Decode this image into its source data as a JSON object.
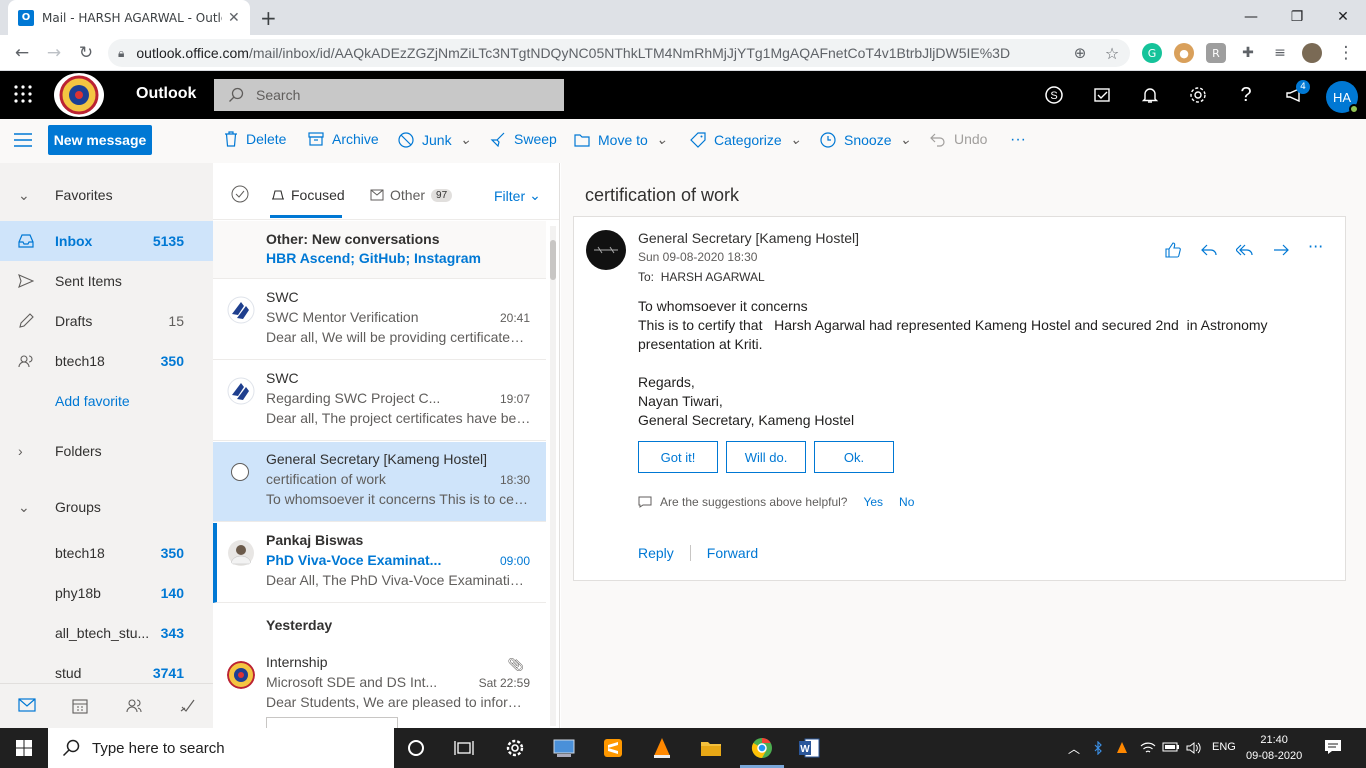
{
  "browser": {
    "tab_title": "Mail - HARSH AGARWAL - Outlo",
    "url_host": "outlook.office.com",
    "url_path": "/mail/inbox/id/AAQkADEzZGZjNmZiLTc3NTgtNDQyNC05NThkLTM4NmRhMjJjYTg1MgAQAFnetCoT4v1BtrbJljDW5IE%3D"
  },
  "header": {
    "app_name": "Outlook",
    "search_placeholder": "Search",
    "notification_count": "4",
    "avatar_initials": "HA"
  },
  "commandbar": {
    "new_message": "New message",
    "delete": "Delete",
    "archive": "Archive",
    "junk": "Junk",
    "sweep": "Sweep",
    "move_to": "Move to",
    "categorize": "Categorize",
    "snooze": "Snooze",
    "undo": "Undo",
    "more": "···"
  },
  "sidebar": {
    "favorites": "Favorites",
    "items": [
      {
        "label": "Inbox",
        "count": "5135"
      },
      {
        "label": "Sent Items",
        "count": ""
      },
      {
        "label": "Drafts",
        "count": "15"
      },
      {
        "label": "btech18",
        "count": "350"
      }
    ],
    "add_favorite": "Add favorite",
    "folders": "Folders",
    "groups": "Groups",
    "group_items": [
      {
        "label": "btech18",
        "count": "350"
      },
      {
        "label": "phy18b",
        "count": "140"
      },
      {
        "label": "all_btech_stu...",
        "count": "343"
      },
      {
        "label": "stud",
        "count": "3741"
      }
    ]
  },
  "list": {
    "focused": "Focused",
    "other": "Other",
    "other_count": "97",
    "filter": "Filter",
    "other_banner_title": "Other: New conversations",
    "other_banner_senders": "HBR Ascend; GitHub; Instagram",
    "messages": [
      {
        "sender": "SWC",
        "subject": "SWC Mentor Verification",
        "time": "20:41",
        "preview": "Dear all, We will be providing certificates to the"
      },
      {
        "sender": "SWC",
        "subject": "Regarding SWC Project C...",
        "time": "19:07",
        "preview": "Dear all, The project certificates have been"
      },
      {
        "sender": "General Secretary [Kameng Hostel]",
        "subject": "certification of work",
        "time": "18:30",
        "preview": "To whomsoever it concerns This is to certify that"
      },
      {
        "sender": "Pankaj Biswas",
        "subject": "PhD Viva-Voce Examinat...",
        "time": "09:00",
        "preview": "Dear All, The PhD Viva-Voce Examination of"
      }
    ],
    "yesterday": "Yesterday",
    "yesterday_messages": [
      {
        "sender": "Internship",
        "subject": "Microsoft SDE and DS Int...",
        "time": "Sat 22:59",
        "preview": "Dear Students, We are pleased to inform you"
      }
    ]
  },
  "reading": {
    "subject": "certification of work",
    "from": "General Secretary [Kameng Hostel]",
    "date": "Sun 09-08-2020 18:30",
    "to_label": "To:",
    "to": "HARSH AGARWAL",
    "body": [
      "To whomsoever it concerns",
      "This is to certify that   Harsh Agarwal had represented Kameng Hostel and secured 2nd  in Astronomy presentation at Kriti.",
      "",
      "Regards,",
      "Nayan Tiwari,",
      "General Secretary, Kameng Hostel"
    ],
    "suggestions": [
      "Got it!",
      "Will do.",
      "Ok."
    ],
    "helpful_q": "Are the suggestions above helpful?",
    "yes": "Yes",
    "no": "No",
    "reply": "Reply",
    "forward": "Forward"
  },
  "taskbar": {
    "search_placeholder": "Type here to search",
    "lang": "ENG",
    "time": "21:40",
    "date": "09-08-2020"
  }
}
